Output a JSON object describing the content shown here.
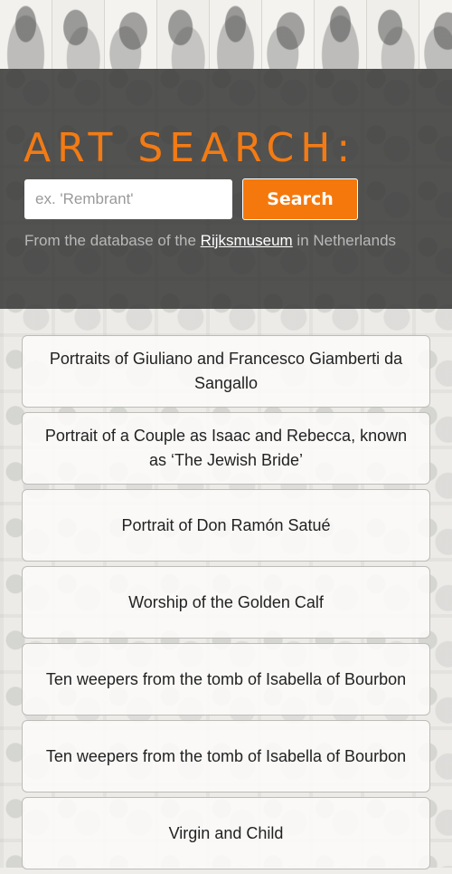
{
  "header": {
    "title": "ART SEARCH:",
    "search_placeholder": "ex. 'Rembrant'",
    "search_value": "",
    "search_button_label": "Search",
    "source_prefix": "From the database of the ",
    "source_link_label": "Rijksmuseum",
    "source_suffix": " in Netherlands"
  },
  "results": [
    {
      "title": "Portraits of Giuliano and Francesco Giamberti da Sangallo"
    },
    {
      "title": "Portrait of a Couple as Isaac and Rebecca, known as ‘The Jewish Bride’"
    },
    {
      "title": "Portrait of Don Ramón Satué"
    },
    {
      "title": "Worship of the Golden Calf"
    },
    {
      "title": "Ten weepers from the tomb of Isabella of Bourbon"
    },
    {
      "title": "Ten weepers from the tomb of Isabella of Bourbon"
    },
    {
      "title": "Virgin and Child"
    }
  ],
  "colors": {
    "accent": "#f5780c",
    "hero_overlay": "#303030",
    "page_background": "#efede9"
  }
}
